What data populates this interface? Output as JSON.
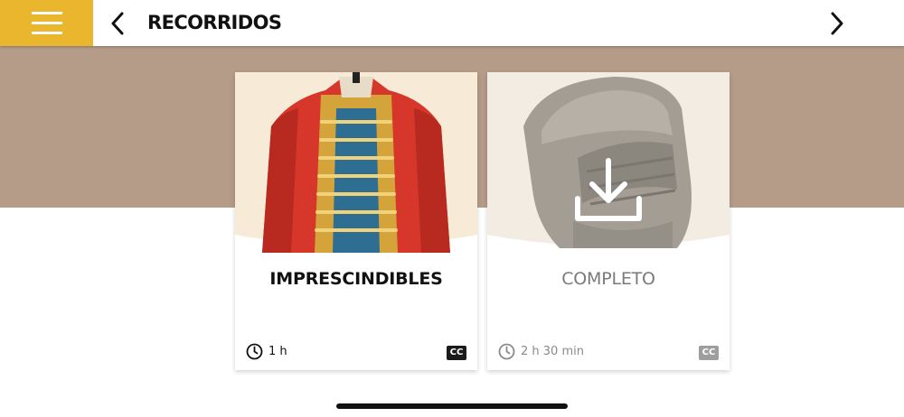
{
  "header": {
    "title": "RECORRIDOS",
    "menu_icon": "hamburger-menu-icon",
    "back_icon": "chevron-left-icon",
    "next_icon": "chevron-right-icon",
    "accent_color": "#e9b62e"
  },
  "band_color": "#b49c88",
  "tours": [
    {
      "title": "IMPRESCINDIBLES",
      "duration": "1 h",
      "captions": "CC",
      "image": "red-hussar-uniform-jacket",
      "downloaded": true
    },
    {
      "title": "COMPLETO",
      "duration": "2 h 30 min",
      "captions": "CC",
      "image": "armor-helmet",
      "downloaded": false,
      "overlay_icon": "download-icon"
    }
  ]
}
